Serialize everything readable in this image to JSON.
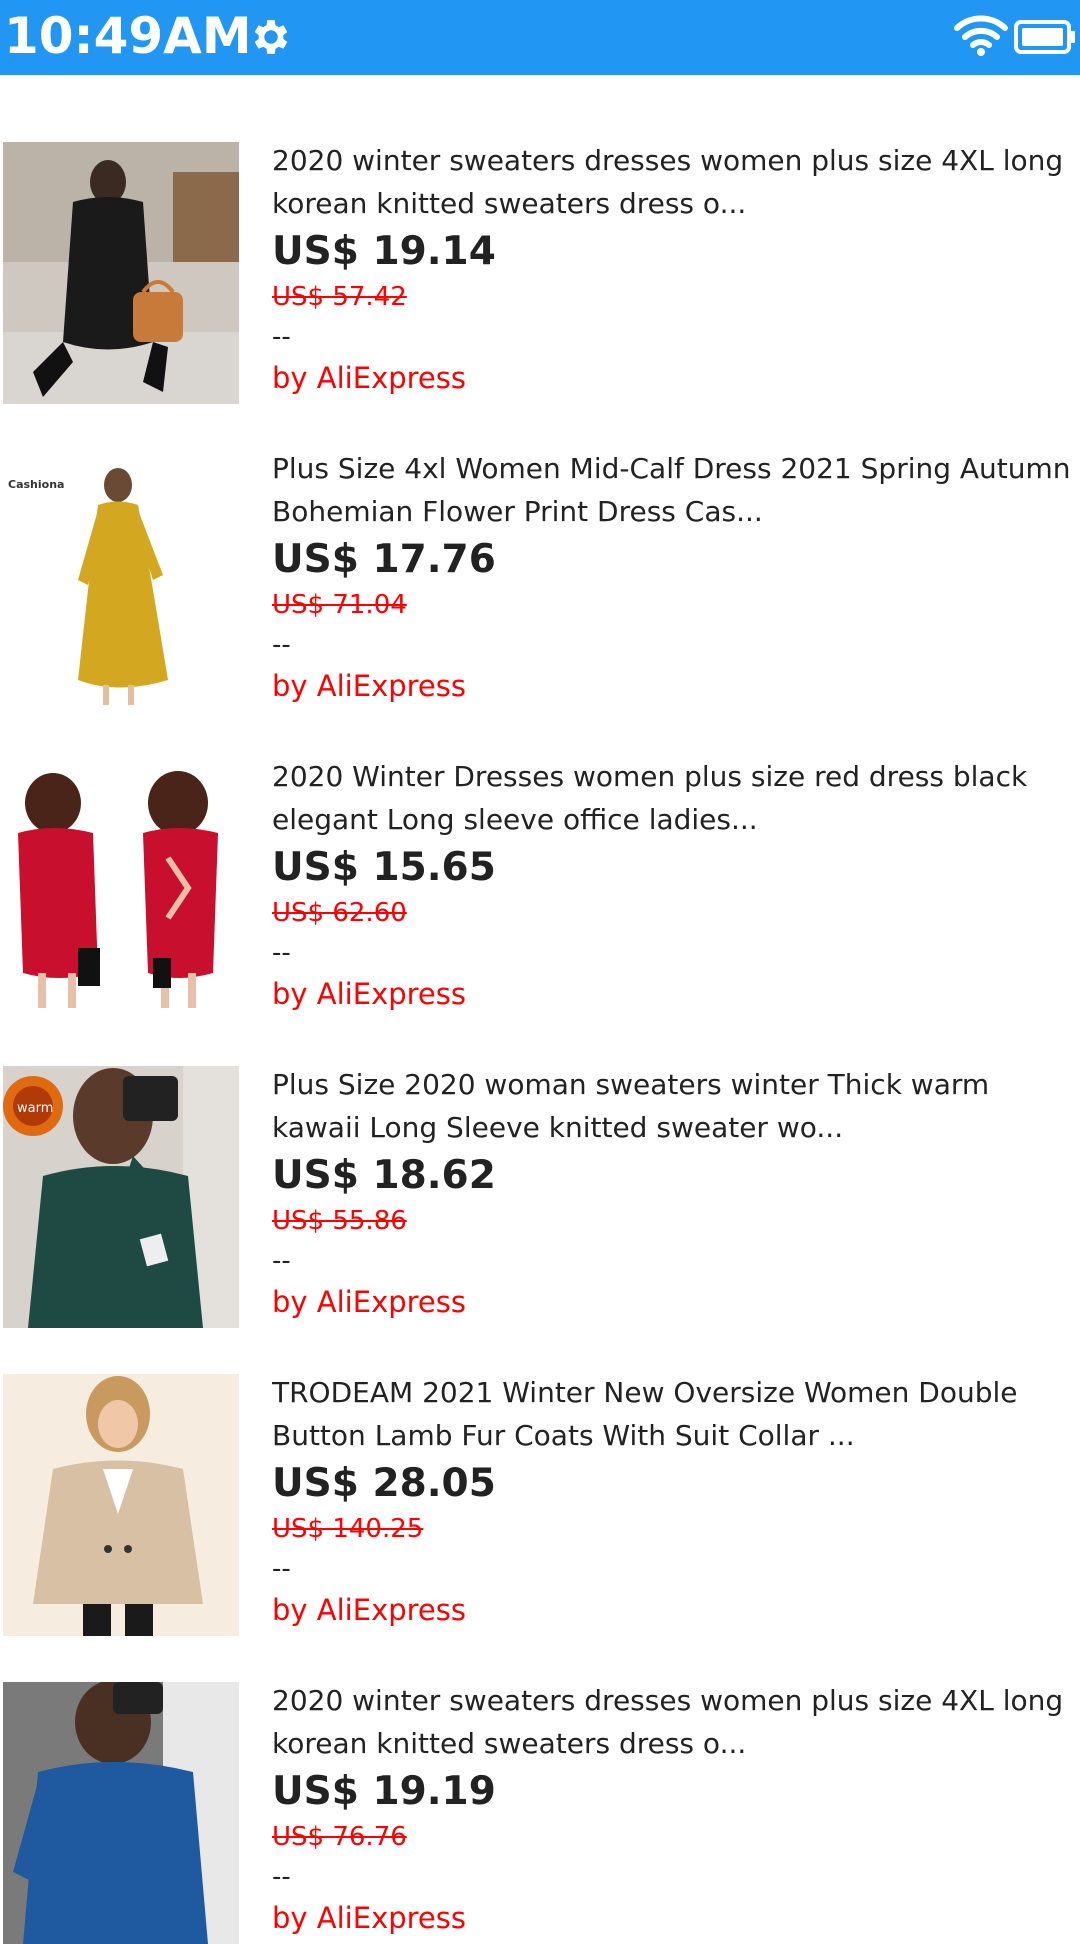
{
  "status_bar": {
    "time": "10:49AM",
    "color": "#2196F3"
  },
  "products": [
    {
      "title": "2020 winter sweaters dresses women plus size 4XL long korean knitted sweaters dress o...",
      "price": "US$ 19.14",
      "original_price": "US$ 57.42",
      "rating": "--",
      "seller": "by AliExpress",
      "image": "black-knit-sweater-dress-photo"
    },
    {
      "title": "Plus Size 4xl Women Mid-Calf Dress 2021 Spring Autumn Bohemian Flower Print Dress Cas...",
      "price": "US$ 17.76",
      "original_price": "US$ 71.04",
      "rating": "--",
      "seller": "by AliExpress",
      "image": "yellow-print-dress-photo",
      "image_text": "Cashiona"
    },
    {
      "title": "2020 Winter Dresses women plus size red dress black elegant Long sleeve office ladies...",
      "price": "US$ 15.65",
      "original_price": "US$ 62.60",
      "rating": "--",
      "seller": "by AliExpress",
      "image": "red-dress-photo"
    },
    {
      "title": "Plus Size 2020 woman sweaters winter Thick warm kawaii Long Sleeve knitted sweater wo...",
      "price": "US$ 18.62",
      "original_price": "US$ 55.86",
      "rating": "--",
      "seller": "by AliExpress",
      "image": "green-sweater-photo",
      "image_text": "warm"
    },
    {
      "title": "TRODEAM 2021 Winter New Oversize Women Double Button Lamb Fur Coats With Suit Collar ...",
      "price": "US$ 28.05",
      "original_price": "US$ 140.25",
      "rating": "--",
      "seller": "by AliExpress",
      "image": "beige-lamb-fur-coat-photo"
    },
    {
      "title": "2020 winter sweaters dresses women plus size 4XL long korean knitted sweaters dress o...",
      "price": "US$ 19.19",
      "original_price": "US$ 76.76",
      "rating": "--",
      "seller": "by AliExpress",
      "image": "blue-sweater-photo"
    }
  ],
  "colors": {
    "accent": "#2196F3",
    "sale": "#ff0000",
    "text": "#222222"
  }
}
